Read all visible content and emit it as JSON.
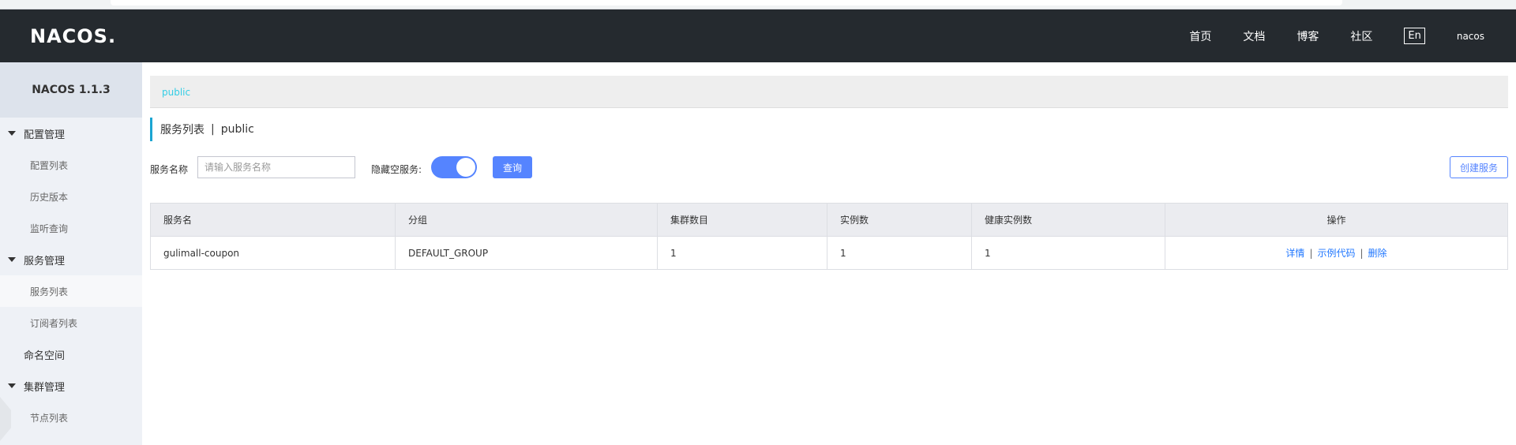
{
  "header": {
    "logo": "NACOS.",
    "nav": [
      "首页",
      "文档",
      "博客",
      "社区"
    ],
    "lang": "En",
    "user": "nacos"
  },
  "sidebar": {
    "brand": "NACOS 1.1.3",
    "groups": {
      "config": "配置管理",
      "service": "服务管理",
      "cluster": "集群管理"
    },
    "items": {
      "config_list": "配置列表",
      "history": "历史版本",
      "listener": "监听查询",
      "service_list": "服务列表",
      "subscriber_list": "订阅者列表",
      "namespace": "命名空间",
      "node_list": "节点列表"
    }
  },
  "namespace_bar": {
    "current": "public"
  },
  "page": {
    "title": "服务列表",
    "separator": "|",
    "namespace": "public"
  },
  "search": {
    "label": "服务名称",
    "placeholder": "请输入服务名称",
    "hide_empty_label": "隐藏空服务:",
    "hide_empty_on": true,
    "query_label": "查询",
    "create_label": "创建服务"
  },
  "table": {
    "columns": [
      "服务名",
      "分组",
      "集群数目",
      "实例数",
      "健康实例数",
      "操作"
    ],
    "rows": [
      {
        "name": "gulimall-coupon",
        "group": "DEFAULT_GROUP",
        "clusters": "1",
        "instances": "1",
        "healthy": "1",
        "actions": [
          "详情",
          "示例代码",
          "删除"
        ]
      }
    ]
  },
  "colors": {
    "topbar": "#252a2f",
    "accent": "#5584ff",
    "link": "#2077ff",
    "namespace_link": "#33cde5"
  }
}
